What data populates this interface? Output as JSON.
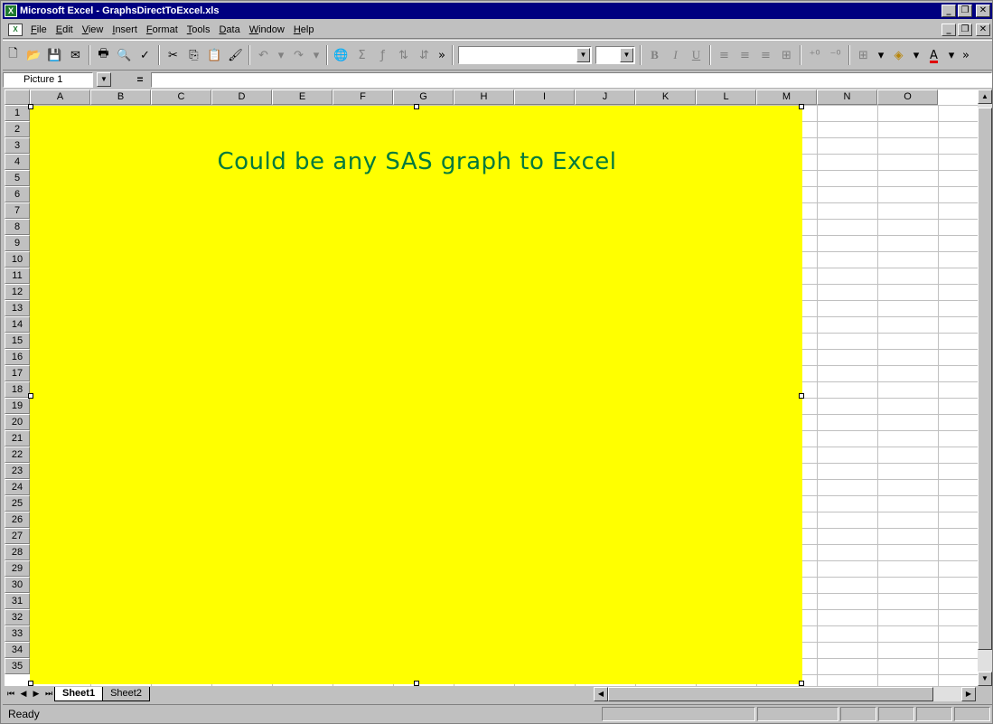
{
  "window": {
    "title": "Microsoft Excel - GraphsDirectToExcel.xls"
  },
  "menu": {
    "items": [
      "File",
      "Edit",
      "View",
      "Insert",
      "Format",
      "Tools",
      "Data",
      "Window",
      "Help"
    ]
  },
  "toolbar": {
    "icons": [
      "new-icon",
      "open-icon",
      "save-icon",
      "email-icon",
      "print-icon",
      "print-preview-icon",
      "spelling-icon",
      "cut-icon",
      "copy-icon",
      "paste-icon",
      "format-painter-icon",
      "undo-icon",
      "redo-icon",
      "hyperlink-icon",
      "autosum-icon",
      "function-icon",
      "sort-ascending-icon",
      "sort-descending-icon",
      "more-buttons-icon"
    ],
    "font_name": "",
    "font_size": ""
  },
  "formula_bar": {
    "name_box": "Picture 1",
    "equals": "=",
    "formula": ""
  },
  "grid": {
    "columns": [
      "A",
      "B",
      "C",
      "D",
      "E",
      "F",
      "G",
      "H",
      "I",
      "J",
      "K",
      "L",
      "M",
      "N",
      "O"
    ],
    "rows": [
      "1",
      "2",
      "3",
      "4",
      "5",
      "6",
      "7",
      "8",
      "9",
      "10",
      "11",
      "12",
      "13",
      "14",
      "15",
      "16",
      "17",
      "18",
      "19",
      "20",
      "21",
      "22",
      "23",
      "24",
      "25",
      "26",
      "27",
      "28",
      "29",
      "30",
      "31",
      "32",
      "33",
      "34",
      "35"
    ]
  },
  "picture": {
    "text": "Could be any SAS graph to Excel",
    "background": "#ffff00",
    "text_color": "#007a3d"
  },
  "sheets": {
    "tabs": [
      "Sheet1",
      "Sheet2"
    ],
    "active": "Sheet1"
  },
  "status": {
    "text": "Ready"
  }
}
